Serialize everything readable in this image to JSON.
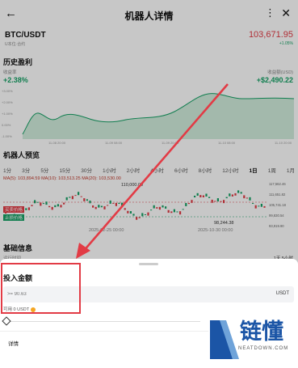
{
  "header": {
    "title": "机器人详情",
    "back": "←",
    "more": "⋮",
    "close": "✕"
  },
  "pair": {
    "name": "BTC/USDT",
    "sub": "U本位·合约",
    "price": "103,671.95",
    "change": "+1.05%"
  },
  "history": {
    "title": "历史盈利",
    "left_label": "收益率",
    "left_value": "+2.38%",
    "right_label": "收益额(USD)",
    "right_value": "+$2,490.22",
    "y_ticks": [
      "+3.00%",
      "+2.00%",
      "+1.00%",
      "0.00%",
      "-1.00%"
    ],
    "x_ticks": [
      "11-08 20:00",
      "11-09 08:00",
      "11-09 20:00",
      "11-10 08:00",
      "11-10 20:00"
    ]
  },
  "preview": {
    "title": "机器人预览",
    "tabs": [
      "1分",
      "3分",
      "5分",
      "15分",
      "30分",
      "1小时",
      "2小时",
      "4小时",
      "6小时",
      "8小时",
      "12小时",
      "1日",
      "1周",
      "1月"
    ],
    "active_tab": "1日",
    "legend": "MA(5): 103,894.59  MA(10): 103,513.25  MA(20): 103,530.00",
    "annot_high": "110,000.00",
    "annot_low": "98,244.38",
    "y_ticks": [
      "117,562.46",
      "111,651.82",
      "105,741.18",
      "99,830.54",
      "93,919.90"
    ],
    "x_ticks": [
      "2025-02-25 00:00",
      "2025-10-30 00:00"
    ],
    "tag1": "买卖价格",
    "tag2": "止损价格"
  },
  "info": {
    "title": "基础信息",
    "row_label": "运行时间",
    "row_value": "1天 5小时"
  },
  "sheet": {
    "invest_title": "投入金额",
    "placeholder": ">= 90.63",
    "unit": "USDT",
    "available": "可用 0 USDT",
    "detail": "详情"
  },
  "watermark": {
    "cn": "链懂",
    "url": "NEATDOWN.COM"
  },
  "colors": {
    "up": "#16a266",
    "down": "#e23b45",
    "arrow": "#e23b45"
  }
}
